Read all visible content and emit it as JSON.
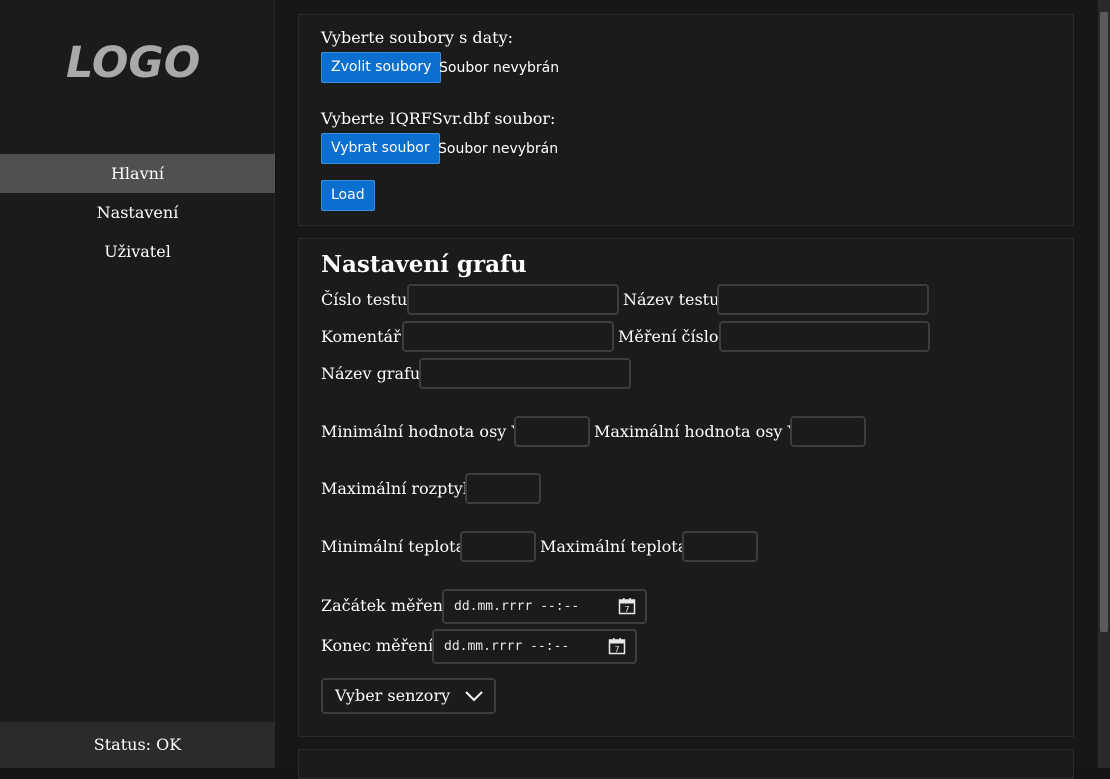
{
  "sidebar": {
    "logo": "LOGO",
    "items": [
      {
        "label": "Hlavní"
      },
      {
        "label": "Nastavení"
      },
      {
        "label": "Uživatel"
      }
    ],
    "status": "Status: OK"
  },
  "upload": {
    "data_files_label": "Vyberte soubory s daty:",
    "data_files_button": "Zvolit soubory",
    "data_files_status": "Soubor nevybrán",
    "dbf_label": "Vyberte IQRFSvr.dbf soubor:",
    "dbf_button": "Vybrat soubor",
    "dbf_status": "Soubor nevybrán",
    "load_button": "Load"
  },
  "graph_settings": {
    "title": "Nastavení grafu",
    "test_number_label": "Číslo testu:",
    "test_name_label": "Název testu:",
    "comment_label": "Komentář:",
    "measurement_number_label": "Měření číslo:",
    "graph_name_label": "Název grafu:",
    "y_min_label": "Minimální hodnota osy Y:",
    "y_max_label": "Maximální hodnota osy Y:",
    "max_variance_label": "Maximální rozptyl:",
    "min_temp_label": "Minimální teplota:",
    "max_temp_label": "Maximální teplota:",
    "start_label": "Začátek měření:",
    "start_placeholder": "dd.mm.rrrr --:--",
    "end_label": "Konec měření:",
    "end_placeholder": "dd.mm.rrrr --:--",
    "sensors_select": "Vyber senzory"
  },
  "colors": {
    "accent": "#0b6fd0",
    "sidebar_active": "#505050",
    "background": "#171717"
  }
}
